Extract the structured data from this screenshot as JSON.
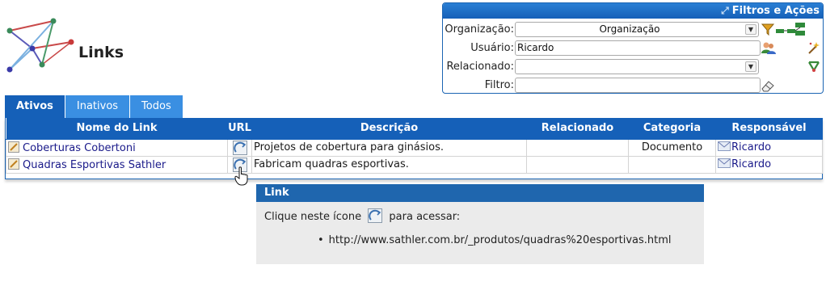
{
  "page": {
    "title": "Links"
  },
  "filters": {
    "header": "Filtros e Ações",
    "organizacao": {
      "label": "Organização:",
      "value": "Organização"
    },
    "usuario": {
      "label": "Usuário:",
      "value": "Ricardo"
    },
    "relacionado": {
      "label": "Relacionado:",
      "value": ""
    },
    "filtro": {
      "label": "Filtro:",
      "value": ""
    }
  },
  "tabs": [
    {
      "label": "Ativos"
    },
    {
      "label": "Inativos"
    },
    {
      "label": "Todos"
    }
  ],
  "table": {
    "columns": [
      "Nome do Link",
      "URL",
      "Descrição",
      "Relacionado",
      "Categoria",
      "Responsável"
    ],
    "rows": [
      {
        "name": "Coberturas Cobertoni",
        "description": "Projetos de cobertura para ginásios.",
        "related": "",
        "category": "Documento",
        "owner": "Ricardo"
      },
      {
        "name": "Quadras Esportivas Sathler",
        "description": "Fabricam quadras esportivas.",
        "related": "",
        "category": "",
        "owner": "Ricardo"
      }
    ]
  },
  "tooltip": {
    "title": "Link",
    "text_before": "Clique neste ícone",
    "text_after": "para acessar:",
    "url": "http://www.sathler.com.br/_produtos/quadras%20esportivas.html"
  }
}
